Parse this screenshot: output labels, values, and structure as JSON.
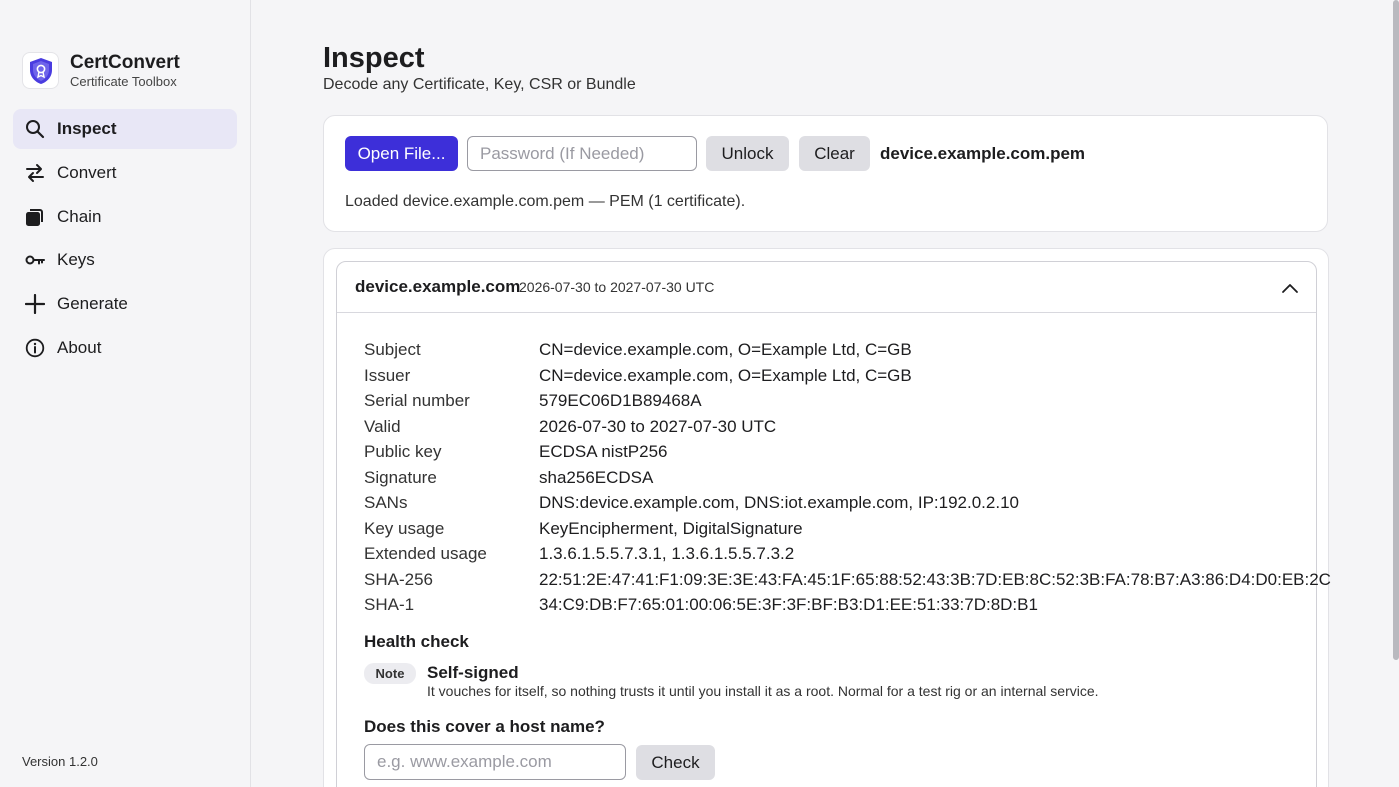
{
  "brand": {
    "name": "CertConvert",
    "subtitle": "Certificate Toolbox"
  },
  "sidebar": {
    "items": [
      {
        "label": "Inspect",
        "icon": "search-icon",
        "active": true
      },
      {
        "label": "Convert",
        "icon": "swap-icon",
        "active": false
      },
      {
        "label": "Chain",
        "icon": "stack-icon",
        "active": false
      },
      {
        "label": "Keys",
        "icon": "key-icon",
        "active": false
      },
      {
        "label": "Generate",
        "icon": "plus-icon",
        "active": false
      },
      {
        "label": "About",
        "icon": "info-icon",
        "active": false
      }
    ],
    "version": "Version 1.2.0"
  },
  "header": {
    "title": "Inspect",
    "subtitle": "Decode any Certificate, Key, CSR or Bundle"
  },
  "loader": {
    "open_label": "Open File...",
    "password_placeholder": "Password (If Needed)",
    "unlock_label": "Unlock",
    "clear_label": "Clear",
    "file_name": "device.example.com.pem",
    "status": "Loaded device.example.com.pem — PEM (1 certificate)."
  },
  "certificate": {
    "common_name": "device.example.com",
    "validity_short": "2026-07-30 to 2027-07-30 UTC",
    "fields": [
      {
        "key": "Subject",
        "value": "CN=device.example.com, O=Example Ltd, C=GB"
      },
      {
        "key": "Issuer",
        "value": "CN=device.example.com, O=Example Ltd, C=GB"
      },
      {
        "key": "Serial number",
        "value": "579EC06D1B89468A"
      },
      {
        "key": "Valid",
        "value": "2026-07-30 to 2027-07-30 UTC"
      },
      {
        "key": "Public key",
        "value": "ECDSA nistP256"
      },
      {
        "key": "Signature",
        "value": "sha256ECDSA"
      },
      {
        "key": "SANs",
        "value": "DNS:device.example.com, DNS:iot.example.com, IP:192.0.2.10"
      },
      {
        "key": "Key usage",
        "value": "KeyEncipherment, DigitalSignature"
      },
      {
        "key": "Extended usage",
        "value": "1.3.6.1.5.5.7.3.1, 1.3.6.1.5.5.7.3.2"
      },
      {
        "key": "SHA-256",
        "value": "22:51:2E:47:41:F1:09:3E:3E:43:FA:45:1F:65:88:52:43:3B:7D:EB:8C:52:3B:FA:78:B7:A3:86:D4:D0:EB:2C"
      },
      {
        "key": "SHA-1",
        "value": "34:C9:DB:F7:65:01:00:06:5E:3F:3F:BF:B3:D1:EE:51:33:7D:8D:B1"
      }
    ]
  },
  "health": {
    "title": "Health check",
    "badge": "Note",
    "note_title": "Self-signed",
    "note_desc": "It vouches for itself, so nothing trusts it until you install it as a root. Normal for a test rig or an internal service."
  },
  "host_check": {
    "title": "Does this cover a host name?",
    "placeholder": "e.g. www.example.com",
    "button_label": "Check"
  },
  "colors": {
    "accent": "#3d2fd9",
    "active_nav_bg": "#e8e7f6"
  }
}
